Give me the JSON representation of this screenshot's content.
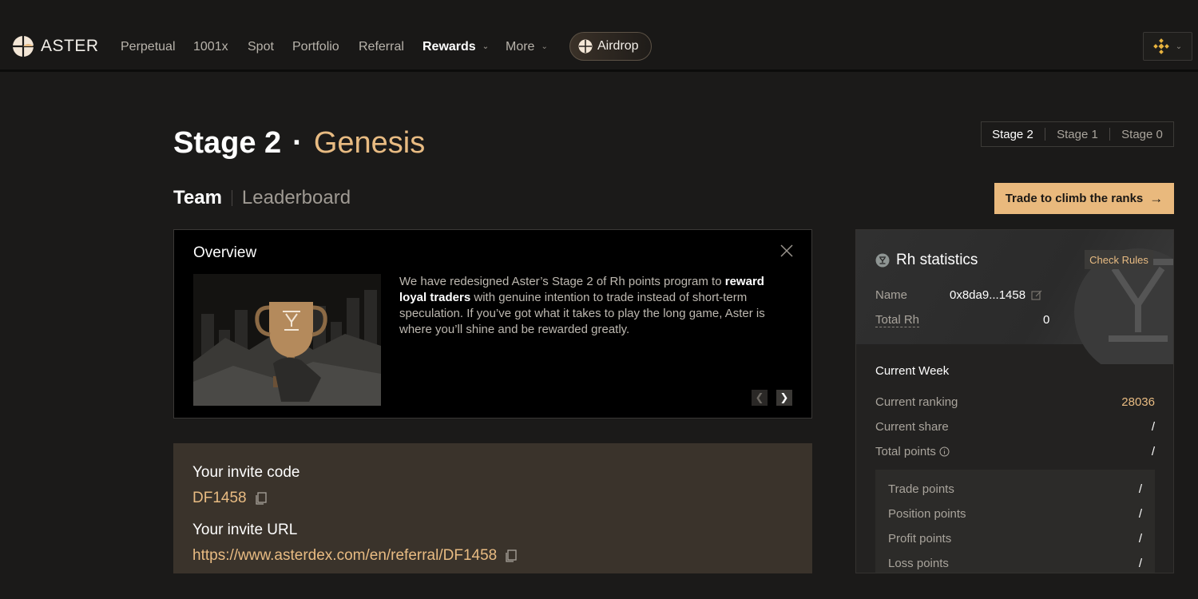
{
  "nav": {
    "brand": "ASTER",
    "items": [
      {
        "label": "Perpetual"
      },
      {
        "label": "1001x"
      },
      {
        "label": "Spot"
      },
      {
        "label": "Portfolio"
      },
      {
        "label": "Referral"
      },
      {
        "label": "Rewards",
        "active": true,
        "has_dropdown": true
      },
      {
        "label": "More",
        "has_dropdown": true
      }
    ],
    "airdrop_label": "Airdrop",
    "wallet_icon": "bnb-chain-icon"
  },
  "header": {
    "title": "Stage 2",
    "separator": "·",
    "title_accent": "Genesis",
    "stage_tabs": [
      "Stage 2",
      "Stage 1",
      "Stage 0"
    ],
    "active_stage": "Stage 2"
  },
  "sub_tabs": {
    "team": "Team",
    "leaderboard": "Leaderboard"
  },
  "cta_label": "Trade to climb the ranks",
  "overview": {
    "title": "Overview",
    "text_1": "We have redesigned Aster’s Stage 2 of Rh points program to ",
    "text_bold": "reward loyal traders",
    "text_2": " with genuine intention to trade instead of short-term speculation. If you’ve got what it takes to play the long game, Aster is where you’ll shine and be rewarded greatly."
  },
  "invite": {
    "code_label": "Your invite code",
    "code": "DF1458",
    "url_label": "Your invite URL",
    "url": "https://www.asterdex.com/en/referral/DF1458"
  },
  "stats": {
    "title": "Rh statistics",
    "check_rules": "Check Rules",
    "name_label": "Name",
    "name_value": "0x8da9...1458",
    "total_rh_label": "Total Rh",
    "total_rh_value": "0",
    "current_week_title": "Current Week",
    "current_ranking_label": "Current ranking",
    "current_ranking_value": "28036",
    "current_share_label": "Current share",
    "current_share_value": "/",
    "total_points_label": "Total points",
    "total_points_value": "/",
    "breakdown": [
      {
        "label": "Trade points",
        "value": "/"
      },
      {
        "label": "Position points",
        "value": "/"
      },
      {
        "label": "Profit points",
        "value": "/"
      },
      {
        "label": "Loss points",
        "value": "/"
      }
    ]
  },
  "colors": {
    "accent_gold": "#e8bb82",
    "cta_bg": "#e9b97d",
    "page_bg": "#1b1a19",
    "invite_bg": "#3a332b"
  }
}
